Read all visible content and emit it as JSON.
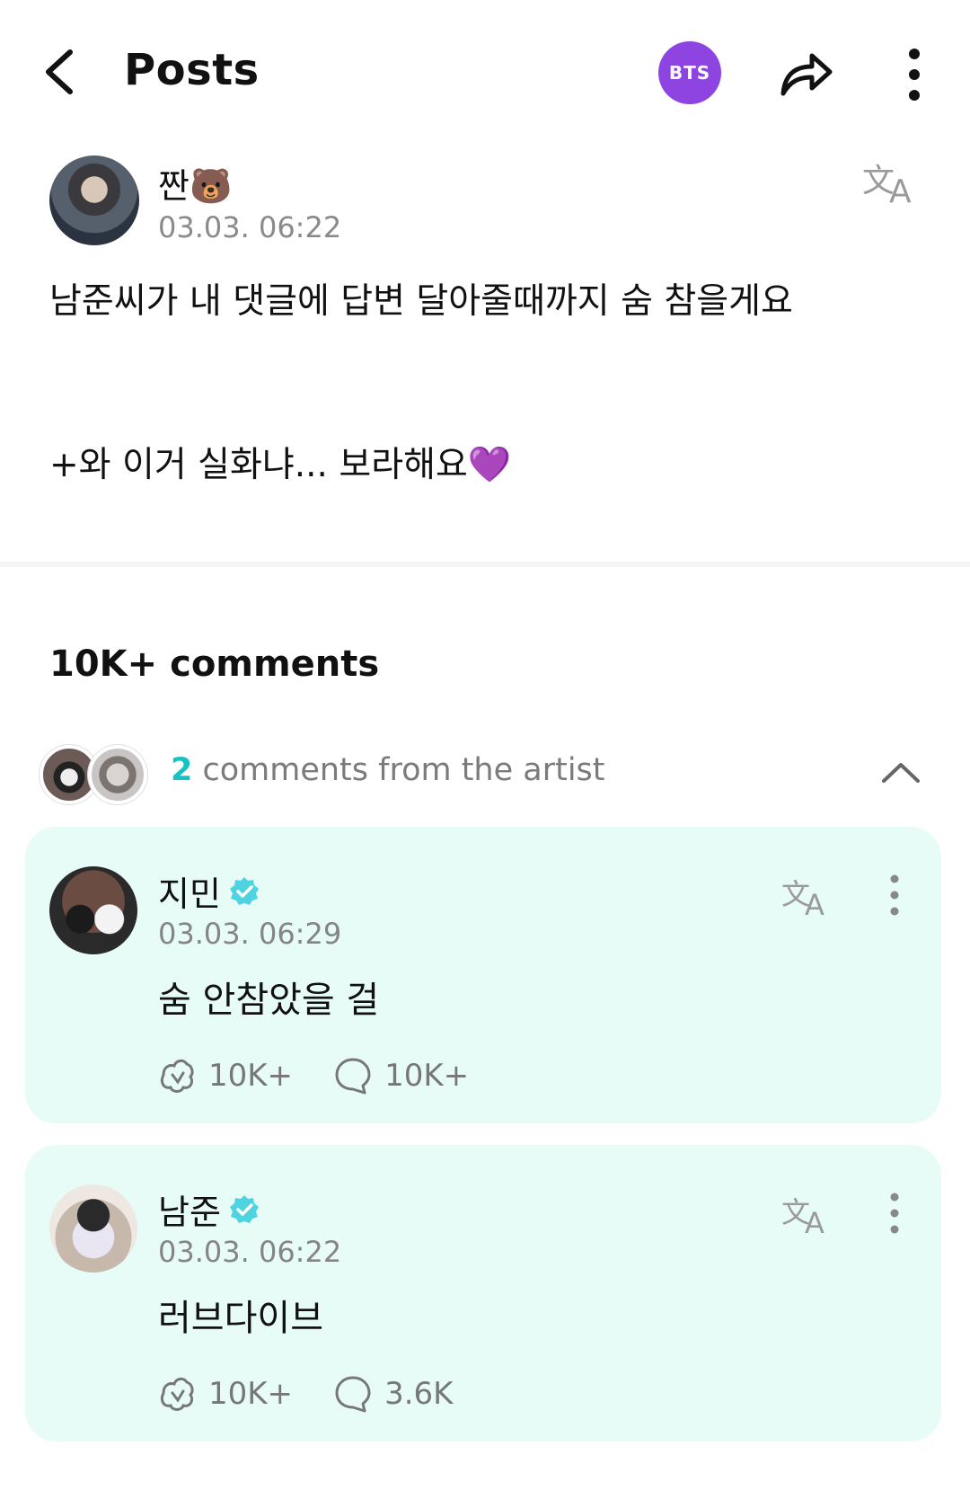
{
  "header": {
    "title": "Posts",
    "community_badge": "BTS"
  },
  "post": {
    "author": "짠🐻",
    "time": "03.03. 06:22",
    "line1": "남준씨가 내 댓글에 답변 달아줄때까지 숨 참을게요",
    "line2": "+와 이거 실화냐... 보라해요💜"
  },
  "comments": {
    "count_label": "10K+ comments",
    "artist_count": "2",
    "artist_label": " comments from the artist",
    "items": [
      {
        "name": "지민",
        "time": "03.03. 06:29",
        "text": "숨 안참았을 걸",
        "likes": "10K+",
        "replies": "10K+"
      },
      {
        "name": "남준",
        "time": "03.03. 06:22",
        "text": "러브다이브",
        "likes": "10K+",
        "replies": "3.6K"
      }
    ]
  },
  "colors": {
    "brand_purple": "#8d44e0",
    "accent_teal": "#17c1c5",
    "card_bg": "#e7fbf7",
    "verified": "#4dd4e0"
  },
  "icons": [
    "back-arrow-icon",
    "share-icon",
    "more-vertical-icon",
    "translate-icon",
    "verified-icon",
    "like-icon",
    "comment-icon",
    "chevron-up-icon"
  ]
}
